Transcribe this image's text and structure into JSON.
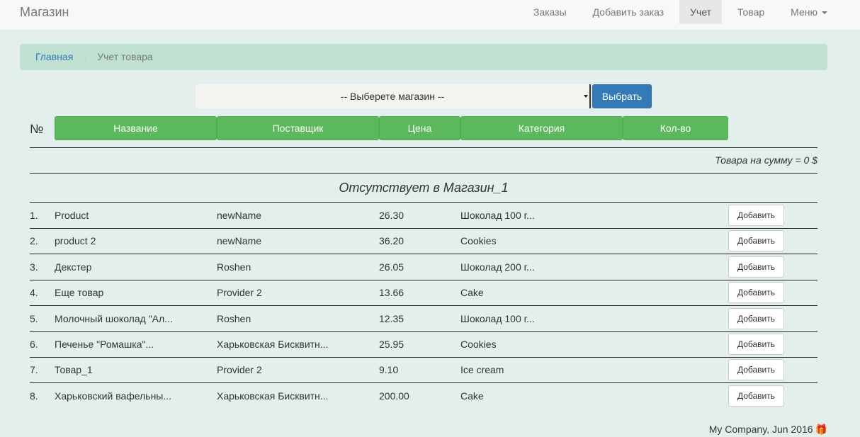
{
  "navbar": {
    "brand": "Магазин",
    "items": [
      {
        "label": "Заказы",
        "active": false
      },
      {
        "label": "Добавить заказ",
        "active": false
      },
      {
        "label": "Учет",
        "active": true
      },
      {
        "label": "Товар",
        "active": false
      },
      {
        "label": "Меню",
        "active": false,
        "dropdown": true
      }
    ]
  },
  "breadcrumb": {
    "home": "Главная",
    "current": "Учет товара"
  },
  "store_select": {
    "placeholder": "-- Выберете магазин --",
    "button": "Выбрать"
  },
  "table": {
    "num_header": "№",
    "headers": [
      "Название",
      "Поставщик",
      "Цена",
      "Категория",
      "Кол-во"
    ],
    "total": "Товара на сумму = 0 $",
    "store_title": "Отсутствует в Магазин_1",
    "add_label": "Добавить",
    "rows": [
      {
        "num": "1.",
        "name": "Product",
        "provider": "newName",
        "price": "26.30",
        "category": "Шоколад 100 г..."
      },
      {
        "num": "2.",
        "name": "product 2",
        "provider": "newName",
        "price": "36.20",
        "category": "Cookies"
      },
      {
        "num": "3.",
        "name": "Декстер",
        "provider": "Roshen",
        "price": "26.05",
        "category": "Шоколад 200 г..."
      },
      {
        "num": "4.",
        "name": "Еще товар",
        "provider": "Provider 2",
        "price": "13.66",
        "category": "Cake"
      },
      {
        "num": "5.",
        "name": "Молочный шоколад \"Ал...",
        "provider": "Roshen",
        "price": "12.35",
        "category": "Шоколад 100 г..."
      },
      {
        "num": "6.",
        "name": "Печенье \"Ромашка\"...",
        "provider": "Харьковская Бисквитн...",
        "price": "25.95",
        "category": "Cookies"
      },
      {
        "num": "7.",
        "name": "Товар_1",
        "provider": "Provider 2",
        "price": "9.10",
        "category": "Ice cream"
      },
      {
        "num": "8.",
        "name": "Харьковский вафельны...",
        "provider": "Харьковская Бисквитн...",
        "price": "200.00",
        "category": "Cake"
      }
    ]
  },
  "footer": {
    "text": "My Company, Jun 2016",
    "icon": "gift-icon"
  }
}
